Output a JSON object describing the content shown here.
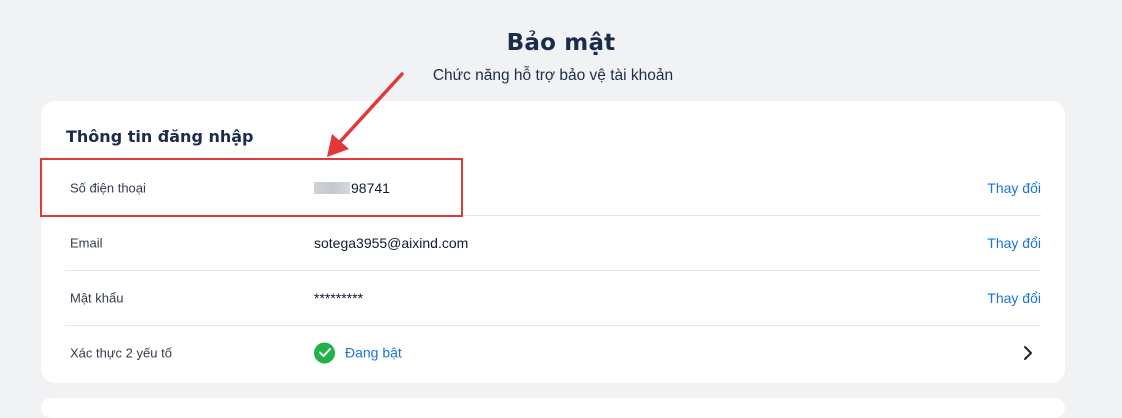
{
  "header": {
    "title": "Bảo mật",
    "subtitle": "Chức năng hỗ trợ bảo vệ tài khoản"
  },
  "login_section": {
    "title": "Thông tin đăng nhập",
    "rows": [
      {
        "label": "Số điện thoại",
        "value": "98741",
        "action": "Thay đổi"
      },
      {
        "label": "Email",
        "value": "sotega3955@aixind.com",
        "action": "Thay đổi"
      },
      {
        "label": "Mật khẩu",
        "value": "*********",
        "action": "Thay đổi"
      },
      {
        "label": "Xác thực 2 yếu tố",
        "status": "Đang bật"
      }
    ]
  },
  "colors": {
    "accent": "#1a73d9",
    "success": "#22b24c",
    "annotation": "#e0383b"
  },
  "icons": [
    "check-circle-icon",
    "chevron-right-icon"
  ]
}
